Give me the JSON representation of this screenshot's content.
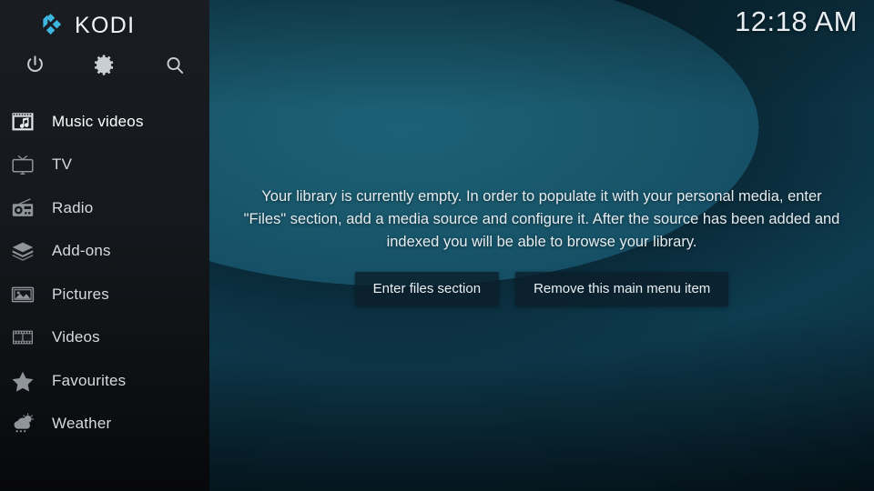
{
  "app": {
    "name": "KODI",
    "logo_icon": "kodi-logo-icon",
    "accent_color": "#3db6e0",
    "sidebar_bg": "#15181c",
    "main_bg": "#155063"
  },
  "header": {
    "clock": "12:18 AM"
  },
  "toolbar": {
    "items": [
      {
        "name": "power",
        "icon": "power-icon",
        "label": "Power"
      },
      {
        "name": "settings",
        "icon": "gear-icon",
        "label": "Settings"
      },
      {
        "name": "search",
        "icon": "search-icon",
        "label": "Search"
      }
    ]
  },
  "sidebar": {
    "items": [
      {
        "label": "Music videos",
        "icon": "music-video-icon",
        "active": true
      },
      {
        "label": "TV",
        "icon": "tv-icon",
        "active": false
      },
      {
        "label": "Radio",
        "icon": "radio-icon",
        "active": false
      },
      {
        "label": "Add-ons",
        "icon": "addons-box-icon",
        "active": false
      },
      {
        "label": "Pictures",
        "icon": "pictures-icon",
        "active": false
      },
      {
        "label": "Videos",
        "icon": "film-strip-icon",
        "active": false
      },
      {
        "label": "Favourites",
        "icon": "star-icon",
        "active": false
      },
      {
        "label": "Weather",
        "icon": "weather-cloud-icon",
        "active": false
      }
    ]
  },
  "main": {
    "empty_message": "Your library is currently empty. In order to populate it with your personal media, enter \"Files\" section, add a media source and configure it. After the source has been added and indexed you will be able to browse your library.",
    "buttons": [
      {
        "label": "Enter files section",
        "name": "enter-files-section-button"
      },
      {
        "label": "Remove this main menu item",
        "name": "remove-main-menu-item-button"
      }
    ]
  }
}
